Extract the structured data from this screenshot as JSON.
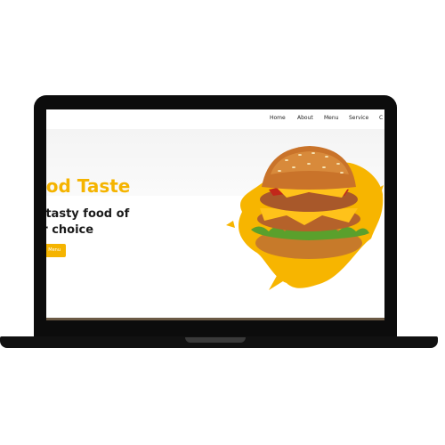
{
  "nav": {
    "items": [
      "Home",
      "About",
      "Menu",
      "Service",
      "C"
    ]
  },
  "hero": {
    "title": "ood Taste",
    "subtitle_line1": "e tasty food of",
    "subtitle_line2": "ur choice",
    "button_label": "Menu"
  },
  "colors": {
    "accent": "#f5b400",
    "text_dark": "#1b1b1b",
    "laptop": "#0c0c0c"
  },
  "images": {
    "hero_image": "burger-illustration"
  }
}
